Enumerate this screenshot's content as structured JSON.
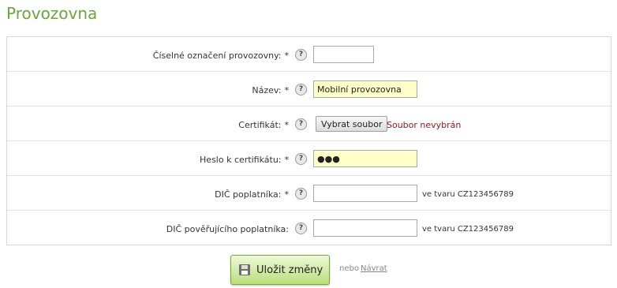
{
  "page": {
    "title": "Provozovna"
  },
  "help_symbol": "?",
  "required_marker": "*",
  "fields": {
    "number": {
      "label": "Číselné označení provozovny:",
      "value": ""
    },
    "name": {
      "label": "Název:",
      "value": "Mobilní provozovna"
    },
    "certificate": {
      "label": "Certifikát:",
      "button_label": "Vybrat soubor",
      "status": "Soubor nevybrán"
    },
    "cert_password": {
      "label": "Heslo k certifikátu:",
      "value": "●●●"
    },
    "taxpayer_dic": {
      "label": "DIČ poplatníka:",
      "value": "",
      "hint": "ve tvaru CZ123456789"
    },
    "delegating_dic": {
      "label": "DIČ pověřujícího poplatníka:",
      "value": "",
      "hint": "ve tvaru CZ123456789"
    }
  },
  "actions": {
    "save_label": "Uložit změny",
    "or_text": "nebo",
    "back_label": "Návrat"
  },
  "colors": {
    "title": "#6aa83a",
    "filled_input": "#ffffc8",
    "save_button": "#b9df7a",
    "file_status": "#8b1a1a"
  }
}
